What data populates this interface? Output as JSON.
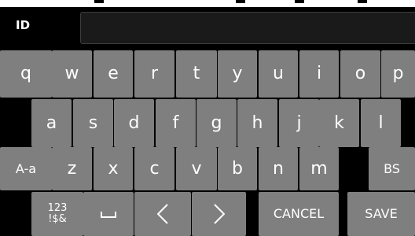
{
  "header": {
    "id_label": "ID",
    "id_value": ""
  },
  "keyboard": {
    "row1": [
      "q",
      "w",
      "e",
      "r",
      "t",
      "y",
      "u",
      "i",
      "o",
      "p"
    ],
    "row2": [
      "a",
      "s",
      "d",
      "f",
      "g",
      "h",
      "j",
      "k",
      "l"
    ],
    "row3": [
      "A-a",
      "z",
      "x",
      "c",
      "v",
      "b",
      "n",
      "m",
      "BS"
    ],
    "row4": {
      "symbols_line1": "123",
      "symbols_line2": "!$&",
      "space_icon": "space-bar-icon",
      "left_icon": "arrow-left-icon",
      "right_icon": "arrow-right-icon",
      "cancel": "CANCEL",
      "save": "SAVE"
    }
  },
  "colors": {
    "background": "#000000",
    "key": "#7f7f7f",
    "key_text": "#ffffff",
    "field": "#1a1a1a"
  }
}
